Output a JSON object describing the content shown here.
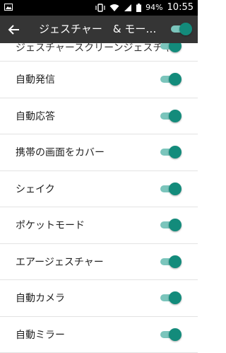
{
  "status_bar": {
    "battery": "94%",
    "time": "10:55"
  },
  "toolbar": {
    "title": "ジェスチャー　& モー…"
  },
  "list": {
    "partial_item": "ジェスチャースクリーンジェスチャ",
    "items": [
      {
        "label": "自動発信"
      },
      {
        "label": "自動応答"
      },
      {
        "label": "携帯の画面をカバー"
      },
      {
        "label": "シェイク"
      },
      {
        "label": "ポケットモード"
      },
      {
        "label": "エアージェスチャー"
      },
      {
        "label": "自動カメラ"
      },
      {
        "label": "自動ミラー"
      }
    ]
  },
  "colors": {
    "accent": "#138b7b",
    "track": "#7bc5bc",
    "toolbar": "#353535"
  }
}
